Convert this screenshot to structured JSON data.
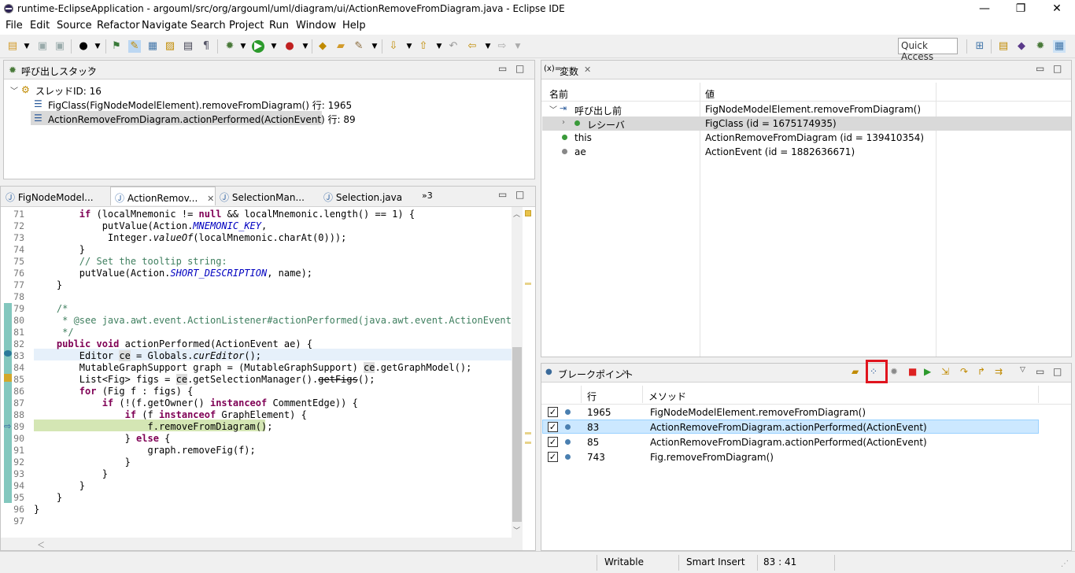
{
  "window": {
    "title": "runtime-EclipseApplication - argouml/src/org/argouml/uml/diagram/ui/ActionRemoveFromDiagram.java - Eclipse IDE",
    "minimize": "—",
    "restore": "❐",
    "close": "✕"
  },
  "menu": [
    "File",
    "Edit",
    "Source",
    "Refactor",
    "Navigate",
    "Search",
    "Project",
    "Run",
    "Window",
    "Help"
  ],
  "quick_access": "Quick Access",
  "callstack": {
    "title": "呼び出しスタック",
    "thread": "スレッドID: 16",
    "frames": [
      "FigClass(FigNodeModelElement).removeFromDiagram() 行: 1965",
      "ActionRemoveFromDiagram.actionPerformed(ActionEvent) 行: 89"
    ]
  },
  "editor": {
    "tabs": [
      "FigNodeModel...",
      "ActionRemov...",
      "SelectionMan...",
      "Selection.java"
    ],
    "overflow": "»3",
    "line_numbers": [
      "71",
      "72",
      "73",
      "74",
      "75",
      "76",
      "77",
      "78",
      "79",
      "80",
      "81",
      "82",
      "83",
      "84",
      "85",
      "86",
      "87",
      "88",
      "89",
      "90",
      "91",
      "92",
      "93",
      "94",
      "95",
      "96",
      "97"
    ]
  },
  "variables": {
    "title": "変数",
    "title_prefix": "(x)=",
    "col_name": "名前",
    "col_value": "値",
    "rows": [
      {
        "name": "呼び出し前",
        "value": "FigNodeModelElement.removeFromDiagram()"
      },
      {
        "name": "レシーバ",
        "value": "FigClass (id = 1675174935)"
      },
      {
        "name": "this",
        "value": "ActionRemoveFromDiagram (id = 139410354)"
      },
      {
        "name": "ae",
        "value": "ActionEvent (id = 1882636671)"
      }
    ]
  },
  "breakpoints": {
    "title": "ブレークポイント",
    "col_line": "行",
    "col_method": "メソッド",
    "rows": [
      {
        "line": "1965",
        "method": "FigNodeModelElement.removeFromDiagram()"
      },
      {
        "line": "83",
        "method": "ActionRemoveFromDiagram.actionPerformed(ActionEvent)"
      },
      {
        "line": "85",
        "method": "ActionRemoveFromDiagram.actionPerformed(ActionEvent)"
      },
      {
        "line": "743",
        "method": "Fig.removeFromDiagram()"
      }
    ]
  },
  "status": {
    "writable": "Writable",
    "insert_mode": "Smart Insert",
    "position": "83 : 41"
  },
  "colors": {
    "highlight_red": "#e0141e",
    "current_line": "#d4e6b4",
    "selection": "#cce8ff"
  }
}
